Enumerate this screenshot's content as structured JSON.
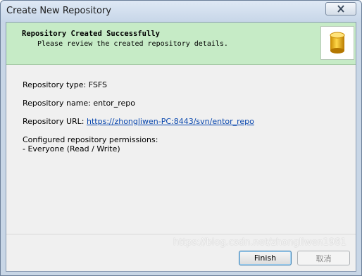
{
  "window": {
    "title": "Create New Repository"
  },
  "banner": {
    "title": "Repository Created Successfully",
    "subtitle": "Please review the created repository details.",
    "icon": "database-cylinder-icon"
  },
  "details": {
    "type_line": "Repository type: FSFS",
    "name_line": "Repository name: entor_repo",
    "url_label": "Repository URL: ",
    "url_value": "https://zhongliwen-PC:8443/svn/entor_repo",
    "permissions_label": "Configured repository permissions:",
    "permissions_value": "- Everyone (Read / Write)"
  },
  "buttons": {
    "finish_label": "Finish",
    "cancel_label": "取消"
  },
  "watermark": "https://blog.csdn.net/zhongliwen1981",
  "colors": {
    "banner_bg": "#c6ebc6",
    "link": "#0645ad",
    "titlebar": "#d3e0ef"
  }
}
